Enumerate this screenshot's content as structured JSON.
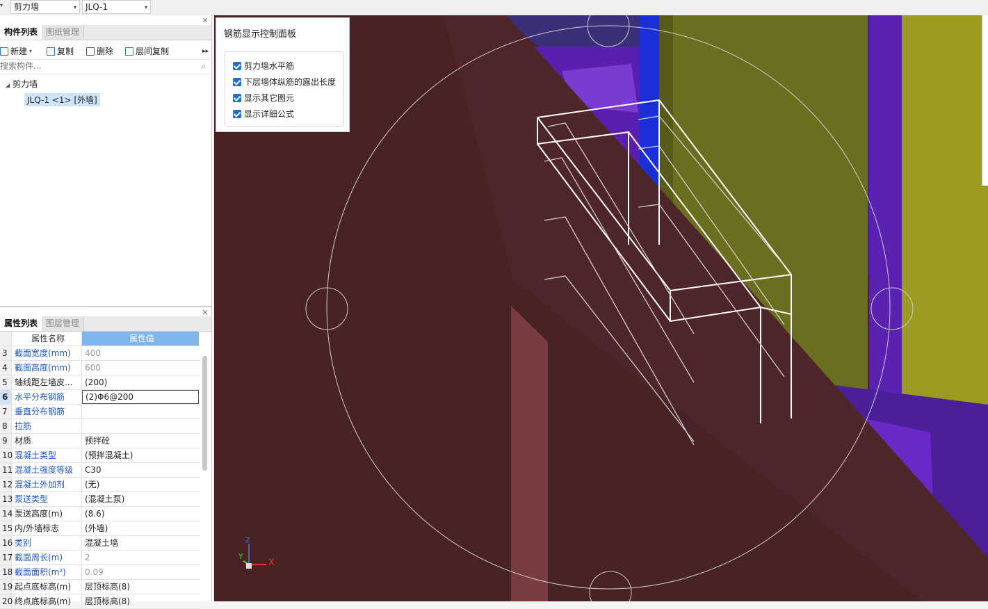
{
  "topbar": {
    "combo1": "剪力墙",
    "combo2": "JLQ-1"
  },
  "component_panel": {
    "tabs": [
      "构件列表",
      "图纸管理"
    ],
    "toolbar": {
      "new": "新建",
      "copy": "复制",
      "delete": "删除",
      "floor_copy": "层间复制"
    },
    "search_placeholder": "搜索构件...",
    "tree": {
      "group": "剪力墙",
      "item": "JLQ-1 <1> [外墙]"
    }
  },
  "property_panel": {
    "tabs": [
      "属性列表",
      "图层管理"
    ],
    "headers": {
      "name": "属性名称",
      "value": "属性值"
    },
    "rows": [
      {
        "n": "3",
        "name": "截面宽度(mm)",
        "value": "400"
      },
      {
        "n": "4",
        "name": "截面高度(mm)",
        "value": "600"
      },
      {
        "n": "5",
        "name": "轴线距左墙皮...",
        "value": "(200)"
      },
      {
        "n": "6",
        "name": "水平分布钢筋",
        "value": "(2)Φ6@200"
      },
      {
        "n": "7",
        "name": "垂直分布钢筋",
        "value": ""
      },
      {
        "n": "8",
        "name": "拉筋",
        "value": ""
      },
      {
        "n": "9",
        "name": "材质",
        "value": "预拌砼"
      },
      {
        "n": "10",
        "name": "混凝土类型",
        "value": "(预拌混凝土)"
      },
      {
        "n": "11",
        "name": "混凝土强度等级",
        "value": "C30"
      },
      {
        "n": "12",
        "name": "混凝土外加剂",
        "value": "(无)"
      },
      {
        "n": "13",
        "name": "泵送类型",
        "value": "(混凝土泵)"
      },
      {
        "n": "14",
        "name": "泵送高度(m)",
        "value": "(8.6)"
      },
      {
        "n": "15",
        "name": "内/外墙标志",
        "value": "(外墙)"
      },
      {
        "n": "16",
        "name": "类别",
        "value": "混凝土墙"
      },
      {
        "n": "17",
        "name": "截面周长(m)",
        "value": "2"
      },
      {
        "n": "18",
        "name": "截面面积(m²)",
        "value": "0.09"
      },
      {
        "n": "19",
        "name": "起点底标高(m)",
        "value": "层顶标高(8)"
      },
      {
        "n": "20",
        "name": "终点底标高(m)",
        "value": "层顶标高(8)"
      }
    ]
  },
  "rebar_panel": {
    "title": "钢筋显示控制面板",
    "options": [
      "剪力墙水平筋",
      "下层墙体纵筋的露出长度",
      "显示其它图元",
      "显示详细公式"
    ]
  },
  "axis": {
    "x": "X",
    "y": "Y",
    "z": "Z"
  },
  "colors": {
    "wall": "#4a2426",
    "yellow": "#6b6e1f",
    "purple": "#5b1fb0",
    "blue": "#1a2fd9",
    "accent": "#1f6fd1"
  }
}
